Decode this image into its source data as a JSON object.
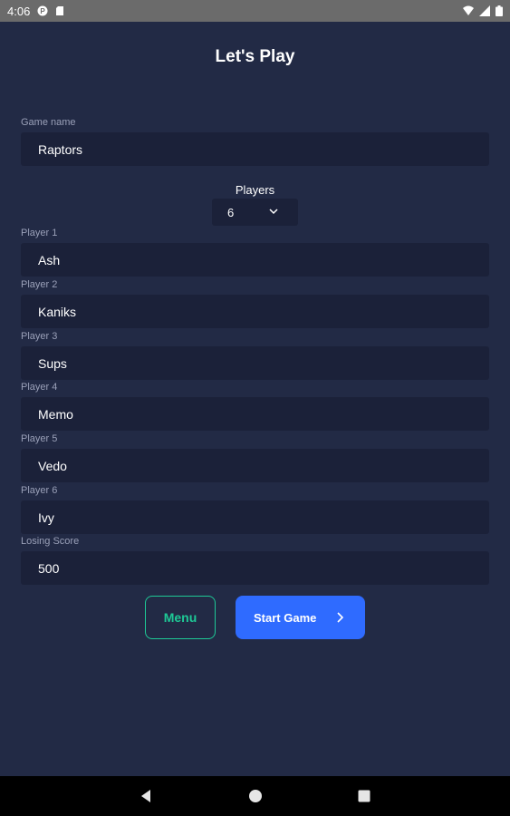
{
  "status_bar": {
    "time": "4:06",
    "icons_left": [
      "privacy-icon",
      "sd-card-icon"
    ],
    "icons_right": [
      "wifi-icon",
      "signal-icon",
      "battery-icon"
    ]
  },
  "title": "Let's Play",
  "game_name": {
    "label": "Game name",
    "value": "Raptors"
  },
  "players": {
    "label": "Players",
    "selected": "6"
  },
  "player_fields": [
    {
      "label": "Player 1",
      "value": "Ash"
    },
    {
      "label": "Player 2",
      "value": "Kaniks"
    },
    {
      "label": "Player 3",
      "value": "Sups"
    },
    {
      "label": "Player 4",
      "value": "Memo"
    },
    {
      "label": "Player 5",
      "value": "Vedo"
    },
    {
      "label": "Player 6",
      "value": "Ivy"
    }
  ],
  "losing_score": {
    "label": "Losing Score",
    "value": "500"
  },
  "buttons": {
    "menu": "Menu",
    "start": "Start Game"
  },
  "colors": {
    "background": "#222a45",
    "field": "#1b2139",
    "accent_green": "#1ec996",
    "primary_blue": "#2f6bff"
  },
  "nav": {
    "icons": [
      "back-icon",
      "home-icon",
      "recents-icon"
    ]
  }
}
